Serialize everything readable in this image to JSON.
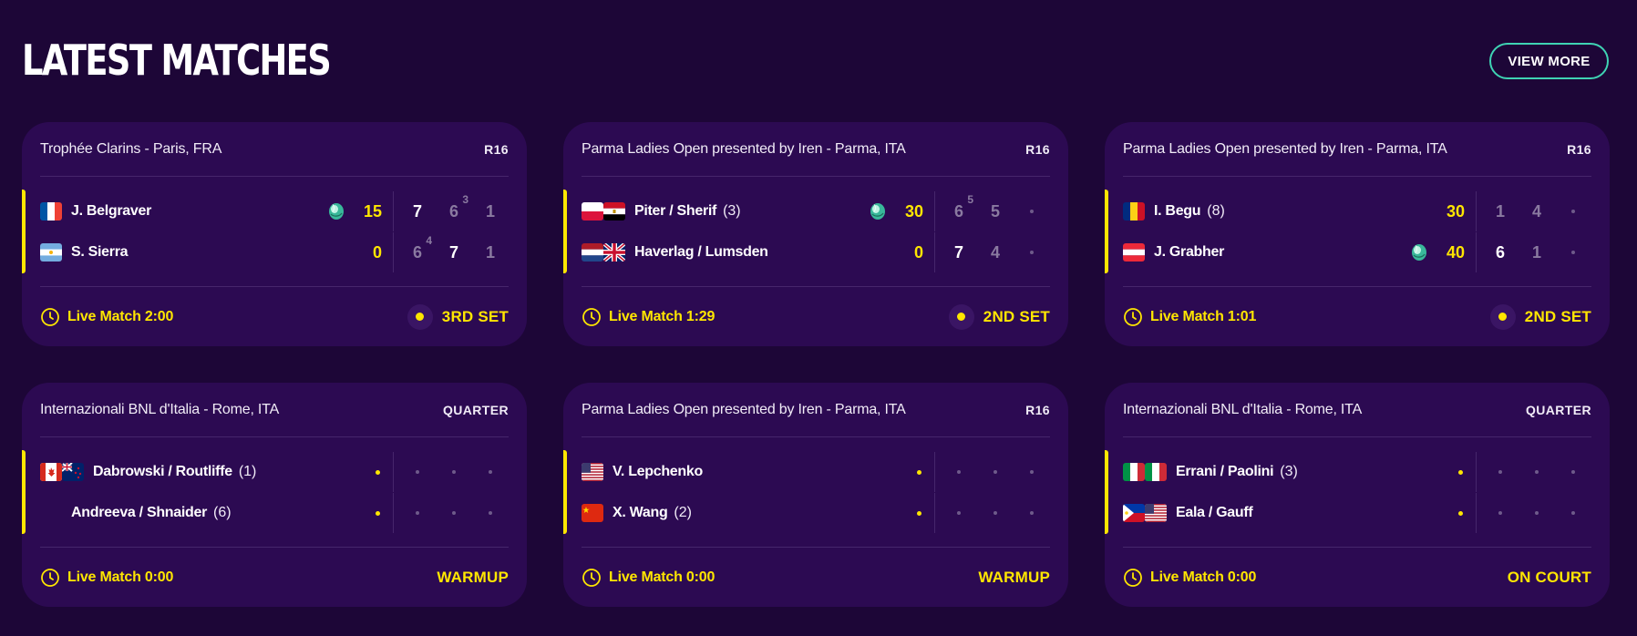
{
  "header": {
    "title": "LATEST MATCHES",
    "view_more_label": "VIEW MORE"
  },
  "colors": {
    "background": "#1d0637",
    "card": "#2c0a52",
    "accent": "#ffe600",
    "button_border": "#3fd3b3"
  },
  "matches": [
    {
      "tournament": "Trophée Clarins - Paris, FRA",
      "round": "R16",
      "live": true,
      "players": [
        {
          "name": "J. Belgraver",
          "seed": "",
          "flags": [
            "france-flag"
          ],
          "serving": true,
          "point": "15",
          "sets": [
            {
              "v": "7",
              "win": true,
              "tb": ""
            },
            {
              "v": "6",
              "win": false,
              "tb": "3"
            },
            {
              "v": "1",
              "win": false,
              "tb": ""
            }
          ]
        },
        {
          "name": "S. Sierra",
          "seed": "",
          "flags": [
            "argentina-flag"
          ],
          "serving": false,
          "point": "0",
          "sets": [
            {
              "v": "6",
              "win": false,
              "tb": "4"
            },
            {
              "v": "7",
              "win": true,
              "tb": ""
            },
            {
              "v": "1",
              "win": false,
              "tb": ""
            }
          ]
        }
      ],
      "timer": "Live Match 2:00",
      "status": "3RD SET",
      "status_dot": true
    },
    {
      "tournament": "Parma Ladies Open presented by Iren - Parma, ITA",
      "round": "R16",
      "live": true,
      "players": [
        {
          "name": "Piter / Sherif",
          "seed": "(3)",
          "flags": [
            "poland-flag",
            "egypt-flag"
          ],
          "serving": true,
          "point": "30",
          "sets": [
            {
              "v": "6",
              "win": false,
              "tb": "5"
            },
            {
              "v": "5",
              "win": false,
              "tb": ""
            },
            {
              "v": "",
              "win": false,
              "tb": "",
              "dot": true
            }
          ]
        },
        {
          "name": "Haverlag / Lumsden",
          "seed": "",
          "flags": [
            "netherlands-flag",
            "uk-flag"
          ],
          "serving": false,
          "point": "0",
          "sets": [
            {
              "v": "7",
              "win": true,
              "tb": ""
            },
            {
              "v": "4",
              "win": false,
              "tb": ""
            },
            {
              "v": "",
              "win": false,
              "tb": "",
              "dot": true
            }
          ]
        }
      ],
      "timer": "Live Match 1:29",
      "status": "2ND SET",
      "status_dot": true
    },
    {
      "tournament": "Parma Ladies Open presented by Iren - Parma, ITA",
      "round": "R16",
      "live": true,
      "players": [
        {
          "name": "I. Begu",
          "seed": "(8)",
          "flags": [
            "romania-flag"
          ],
          "serving": false,
          "point": "30",
          "sets": [
            {
              "v": "1",
              "win": false,
              "tb": ""
            },
            {
              "v": "4",
              "win": false,
              "tb": ""
            },
            {
              "v": "",
              "win": false,
              "tb": "",
              "dot": true
            }
          ]
        },
        {
          "name": "J. Grabher",
          "seed": "",
          "flags": [
            "austria-flag"
          ],
          "serving": true,
          "point": "40",
          "sets": [
            {
              "v": "6",
              "win": true,
              "tb": ""
            },
            {
              "v": "1",
              "win": false,
              "tb": ""
            },
            {
              "v": "",
              "win": false,
              "tb": "",
              "dot": true
            }
          ]
        }
      ],
      "timer": "Live Match 1:01",
      "status": "2ND SET",
      "status_dot": true
    },
    {
      "tournament": "Internazionali BNL d'Italia - Rome, ITA",
      "round": "QUARTER",
      "live": true,
      "players": [
        {
          "name": "Dabrowski / Routliffe",
          "seed": "(1)",
          "flags": [
            "canada-flag",
            "new-zealand-flag"
          ],
          "serving": false,
          "point": "",
          "sets": [
            {
              "dot": true
            },
            {
              "dot": true
            },
            {
              "dot": true
            }
          ]
        },
        {
          "name": "Andreeva / Shnaider",
          "seed": "(6)",
          "flags": [],
          "serving": false,
          "point": "",
          "sets": [
            {
              "dot": true
            },
            {
              "dot": true
            },
            {
              "dot": true
            }
          ]
        }
      ],
      "timer": "Live Match 0:00",
      "status": "WARMUP",
      "status_dot": false
    },
    {
      "tournament": "Parma Ladies Open presented by Iren - Parma, ITA",
      "round": "R16",
      "live": true,
      "players": [
        {
          "name": "V. Lepchenko",
          "seed": "",
          "flags": [
            "usa-flag"
          ],
          "serving": false,
          "point": "",
          "sets": [
            {
              "dot": true
            },
            {
              "dot": true
            },
            {
              "dot": true
            }
          ]
        },
        {
          "name": "X. Wang",
          "seed": "(2)",
          "flags": [
            "china-flag"
          ],
          "serving": false,
          "point": "",
          "sets": [
            {
              "dot": true
            },
            {
              "dot": true
            },
            {
              "dot": true
            }
          ]
        }
      ],
      "timer": "Live Match 0:00",
      "status": "WARMUP",
      "status_dot": false
    },
    {
      "tournament": "Internazionali BNL d'Italia - Rome, ITA",
      "round": "QUARTER",
      "live": true,
      "players": [
        {
          "name": "Errani / Paolini",
          "seed": "(3)",
          "flags": [
            "italy-flag",
            "italy-flag"
          ],
          "serving": false,
          "point": "",
          "sets": [
            {
              "dot": true
            },
            {
              "dot": true
            },
            {
              "dot": true
            }
          ]
        },
        {
          "name": "Eala / Gauff",
          "seed": "",
          "flags": [
            "philippines-flag",
            "usa-flag"
          ],
          "serving": false,
          "point": "",
          "sets": [
            {
              "dot": true
            },
            {
              "dot": true
            },
            {
              "dot": true
            }
          ]
        }
      ],
      "timer": "Live Match 0:00",
      "status": "ON COURT",
      "status_dot": false
    }
  ]
}
